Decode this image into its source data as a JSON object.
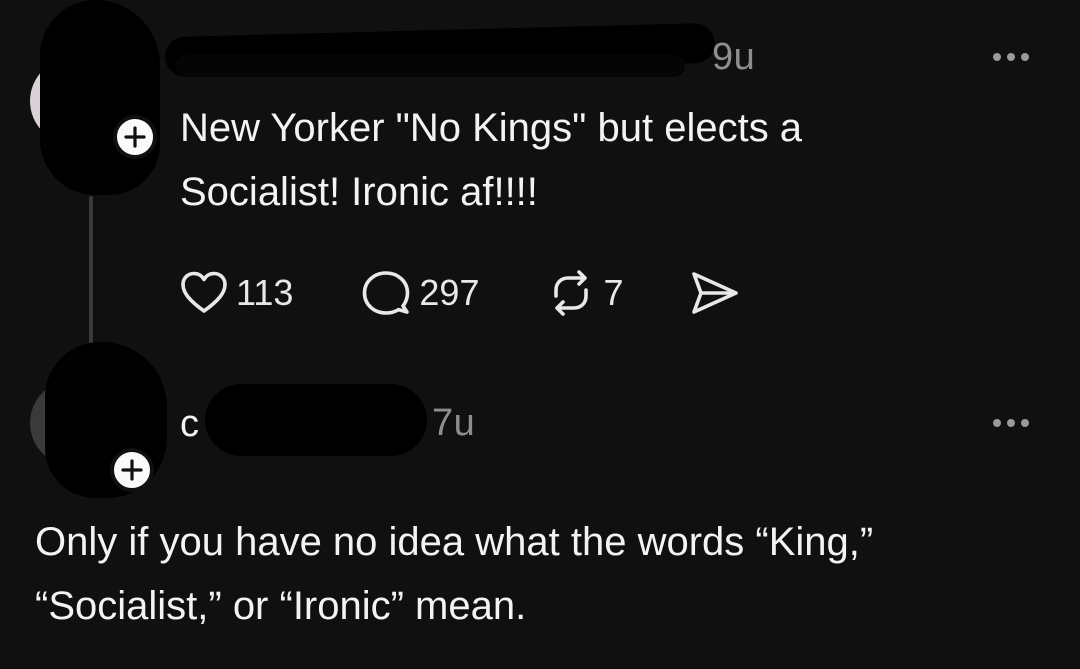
{
  "post": {
    "timestamp": "9u",
    "text": "New Yorker \"No Kings\" but elects a\nSocialist! Ironic af!!!!",
    "likes": "113",
    "replies": "297",
    "reposts": "7"
  },
  "reply": {
    "timestamp": "7u",
    "partial_name": "c",
    "text": "Only if you have no idea what the words “King,”\n“Socialist,” or “Ironic” mean."
  },
  "icons": {
    "like": "heart-icon",
    "reply": "comment-icon",
    "repost": "repost-icon",
    "share": "send-icon",
    "more": "more-dots-icon",
    "follow": "plus-icon"
  }
}
